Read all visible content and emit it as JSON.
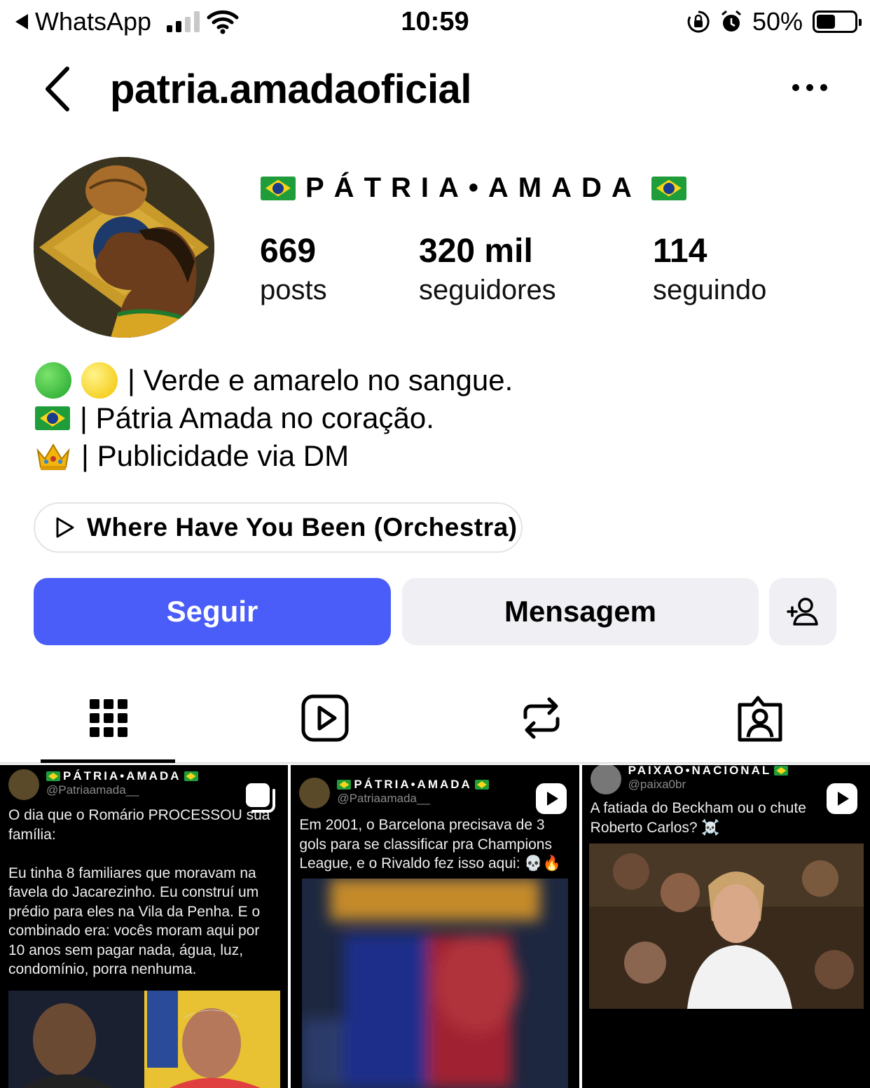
{
  "status_bar": {
    "back_app": "WhatsApp",
    "time": "10:59",
    "battery": "50%",
    "battery_level": 0.5
  },
  "header": {
    "username": "patria.amadaoficial"
  },
  "profile": {
    "display_name": "PÁTRIA•AMADA",
    "stats": [
      {
        "value": "669",
        "label": "posts"
      },
      {
        "value": "320 mil",
        "label": "seguidores"
      },
      {
        "value": "114",
        "label": "seguindo"
      }
    ],
    "bio": [
      "| Verde e amarelo no sangue.",
      "| Pátria Amada no coração.",
      "| Publicidade via DM"
    ],
    "music": "Where Have You Been (Orchestra)"
  },
  "actions": {
    "follow": "Seguir",
    "message": "Mensagem"
  },
  "tabs": [
    "grid-icon",
    "reels-icon",
    "reposts-icon",
    "tagged-icon"
  ],
  "posts": [
    {
      "account": "PÁTRIA•AMADA",
      "handle": "@Patriaamada__",
      "text": "O dia que o Romário PROCESSOU sua família:\n\nEu tinha 8 familiares que moravam na favela do Jacarezinho. Eu construí um prédio para eles na Vila da Penha. E o combinado era: vocês moram aqui por 10 anos sem pagar nada, água, luz, condomínio, porra nenhuma."
    },
    {
      "account": "PÁTRIA•AMADA",
      "handle": "@Patriaamada__",
      "text": "Em 2001, o Barcelona precisava de 3 gols para se classificar pra Champions League, e o Rivaldo fez isso aqui: 💀🔥"
    },
    {
      "account": "PAIXAO•NACIONAL",
      "handle": "@paixa0br",
      "text": "A fatiada do Beckham ou o chute Roberto Carlos? ☠️"
    }
  ],
  "colors": {
    "follow_button": "#4a5df9",
    "secondary_button": "#efeff4"
  }
}
